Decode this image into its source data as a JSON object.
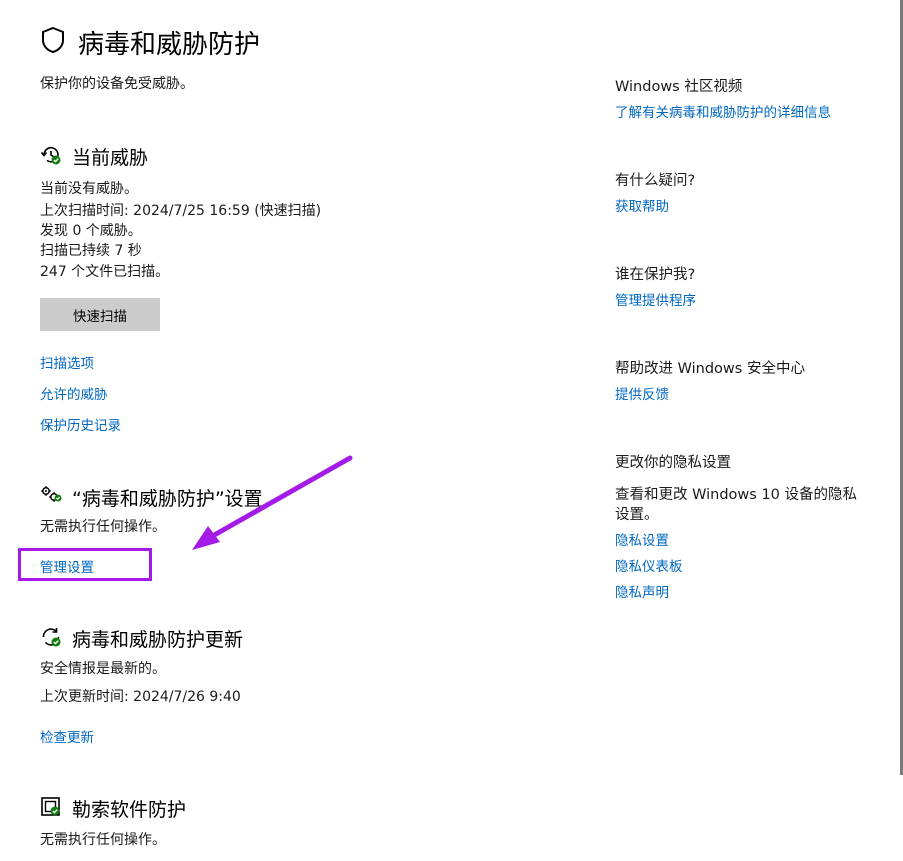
{
  "page": {
    "title": "病毒和威胁防护",
    "subtitle": "保护你的设备免受威胁。"
  },
  "current_threats": {
    "heading": "当前威胁",
    "lines": [
      "当前没有威胁。",
      "上次扫描时间: 2024/7/25 16:59 (快速扫描)",
      "发现 0 个威胁。",
      "扫描已持续 7 秒",
      "247 个文件已扫描。"
    ],
    "quick_scan_label": "快速扫描",
    "links": [
      "扫描选项",
      "允许的威胁",
      "保护历史记录"
    ]
  },
  "settings": {
    "heading": "“病毒和威胁防护”设置",
    "status": "无需执行任何操作。",
    "manage_link": "管理设置"
  },
  "updates": {
    "heading": "病毒和威胁防护更新",
    "status": "安全情报是最新的。",
    "last_update": "上次更新时间: 2024/7/26 9:40",
    "check_link": "检查更新"
  },
  "ransomware": {
    "heading": "勒索软件防护",
    "status": "无需执行任何操作。"
  },
  "right": {
    "community": {
      "title": "Windows 社区视频",
      "link": "了解有关病毒和威胁防护的详细信息"
    },
    "question": {
      "title": "有什么疑问?",
      "link": "获取帮助"
    },
    "protector": {
      "title": "谁在保护我?",
      "link": "管理提供程序"
    },
    "improve": {
      "title": "帮助改进 Windows 安全中心",
      "link": "提供反馈"
    },
    "privacy": {
      "title": "更改你的隐私设置",
      "desc_line1": "查看和更改 Windows 10 设备的隐私",
      "desc_line2": "设置。",
      "links": [
        "隐私设置",
        "隐私仪表板",
        "隐私声明"
      ]
    }
  },
  "colors": {
    "link": "#0067c0",
    "highlight": "#a41be8",
    "ok_green": "#107c10"
  }
}
